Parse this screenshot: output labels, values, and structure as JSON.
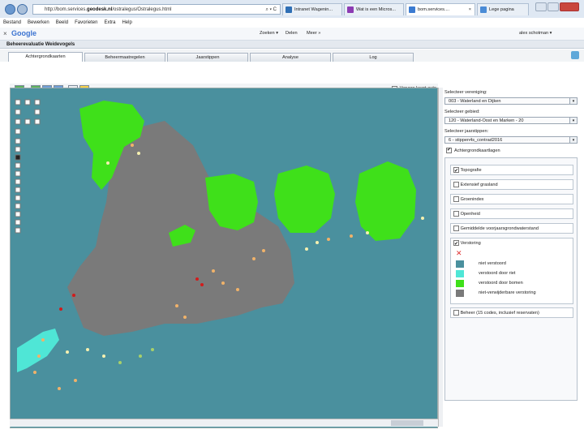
{
  "browser": {
    "address": "http://bom.services.",
    "address_domain": "geodesk.nl",
    "address_path": "/ostralegus/Ostralegus.html",
    "search_hint": "⌕ ▾ C",
    "tabs": [
      {
        "label": "Intranet Wagenin...",
        "icon_color": "#2f6fb5"
      },
      {
        "label": "Wat is een Micros...",
        "icon_color": "#8c3bb3"
      },
      {
        "label": "bom.services....",
        "icon_color": "#3b7bd1"
      },
      {
        "label": "Lege pagina",
        "icon_color": "#4a8bd6"
      }
    ],
    "tab_close": "×"
  },
  "menu": [
    "Bestand",
    "Bewerken",
    "Beeld",
    "Favorieten",
    "Extra",
    "Help"
  ],
  "googlebar": {
    "close": "×",
    "logo": "Google",
    "search_btn": "Zoeken ▾",
    "share_btn": "Delen",
    "more_btn": "Meer »",
    "user": "alex schotman ▾"
  },
  "app": {
    "title": "Beheerevaluatie Weidevogels",
    "tabs": [
      "Achtergrondkaarten",
      "Beheermaatregelen",
      "Jaarstippen",
      "Analyse",
      "Log"
    ]
  },
  "map": {
    "refresh_label": "Ververs kaart auto",
    "land_color": "#7a7a7a",
    "water_color": "#4a909e"
  },
  "panel": {
    "vereniging_label": "Selecteer vereniging:",
    "vereniging_value": "003 - Waterland en Dijken",
    "gebied_label": "Selecteer gebied:",
    "gebied_value": "120 - Waterland-Oost en Marken - 20",
    "jaar_label": "Selecteer jaarstippen:",
    "jaar_value": "6 - stippen4s_contrad2016",
    "layers_title": "Achtergrondkaartlagen",
    "layers": [
      {
        "label": "Topografie",
        "checked": true
      },
      {
        "label": "Extensief grasland",
        "checked": false
      },
      {
        "label": "Groenindex",
        "checked": false
      },
      {
        "label": "Openheid",
        "checked": false
      },
      {
        "label": "Gemiddelde voorjaarsgrondwaterstand",
        "checked": false
      }
    ],
    "verstoring": {
      "label": "Verstoring",
      "legend": [
        {
          "label": "niet verstoord",
          "color": "#4a909e"
        },
        {
          "label": "verstoord door riet",
          "color": "#4fe6d6"
        },
        {
          "label": "verstoord door bomen",
          "color": "#3fe01a"
        },
        {
          "label": "niet-verwijderbare verstoring",
          "color": "#7a7a7a"
        }
      ]
    },
    "beheer_label": "Beheer (15 codes, inclusief reservaten)"
  }
}
